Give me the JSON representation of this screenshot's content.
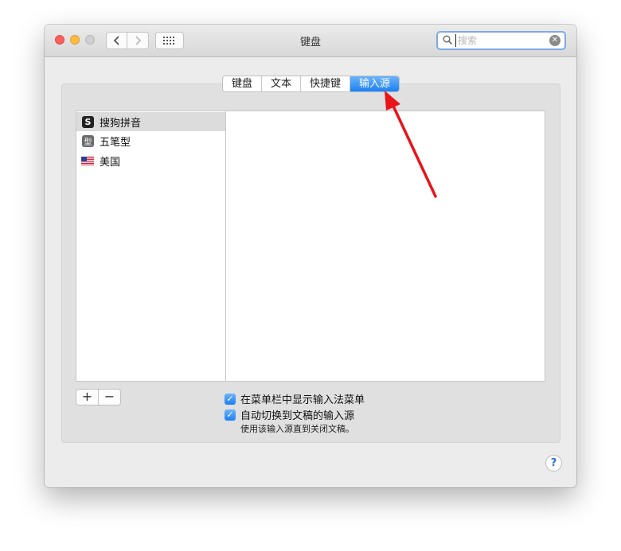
{
  "window": {
    "title": "键盘",
    "search": {
      "placeholder": "搜索"
    }
  },
  "tabs": [
    {
      "label": "键盘",
      "active": false
    },
    {
      "label": "文本",
      "active": false
    },
    {
      "label": "快捷键",
      "active": false
    },
    {
      "label": "输入源",
      "active": true
    }
  ],
  "input_sources": [
    {
      "label": "搜狗拼音",
      "icon": "sogou-s-icon",
      "icon_text": "S",
      "selected": true
    },
    {
      "label": "五笔型",
      "icon": "wubi-icon",
      "icon_text": "型",
      "selected": false
    },
    {
      "label": "美国",
      "icon": "us-flag-icon",
      "selected": false
    }
  ],
  "list_buttons": {
    "add": "+",
    "remove": "−"
  },
  "options": {
    "show_in_menu_bar": {
      "label": "在菜单栏中显示输入法菜单",
      "checked": true
    },
    "auto_switch": {
      "label": "自动切换到文稿的输入源",
      "checked": true
    },
    "note": "使用该输入源直到关闭文稿。"
  },
  "colors": {
    "accent": "#1b7ff3",
    "annotation_arrow": "#e8141a"
  }
}
